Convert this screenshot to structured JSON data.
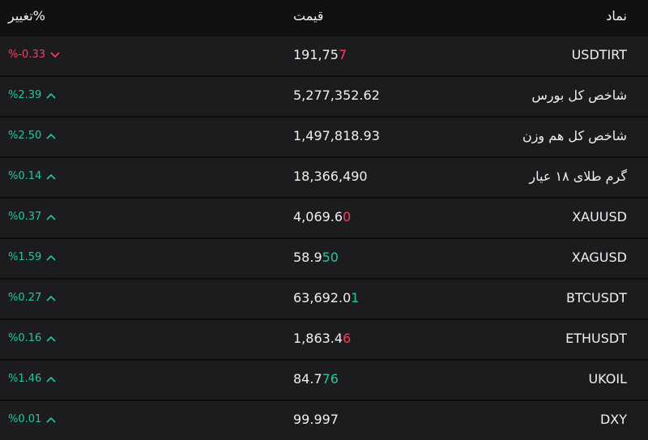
{
  "header": {
    "symbol": "نماد",
    "price": "قیمت",
    "change": "تغییر%"
  },
  "colors": {
    "up": "#26c6a0",
    "down": "#ff3b5c"
  },
  "rows": [
    {
      "symbol": "USDTIRT",
      "price_main": "191,75",
      "price_tail": "7",
      "tail_dir": "down",
      "change": "%-0.33",
      "dir": "down"
    },
    {
      "symbol": "شاخص کل بورس",
      "price_main": "5,277,352.62",
      "price_tail": "",
      "tail_dir": "up",
      "change": "%2.39",
      "dir": "up"
    },
    {
      "symbol": "شاخص کل هم وزن",
      "price_main": "1,497,818.93",
      "price_tail": "",
      "tail_dir": "up",
      "change": "%2.50",
      "dir": "up"
    },
    {
      "symbol": "گرم طلای ۱۸ عیار",
      "price_main": "18,366,490",
      "price_tail": "",
      "tail_dir": "up",
      "change": "%0.14",
      "dir": "up"
    },
    {
      "symbol": "XAUUSD",
      "price_main": "4,069.6",
      "price_tail": "0",
      "tail_dir": "down",
      "change": "%0.37",
      "dir": "up"
    },
    {
      "symbol": "XAGUSD",
      "price_main": "58.9",
      "price_tail": "50",
      "tail_dir": "up",
      "change": "%1.59",
      "dir": "up"
    },
    {
      "symbol": "BTCUSDT",
      "price_main": "63,692.0",
      "price_tail": "1",
      "tail_dir": "up",
      "change": "%0.27",
      "dir": "up"
    },
    {
      "symbol": "ETHUSDT",
      "price_main": "1,863.4",
      "price_tail": "6",
      "tail_dir": "down",
      "change": "%0.16",
      "dir": "up"
    },
    {
      "symbol": "UKOIL",
      "price_main": "84.7",
      "price_tail": "76",
      "tail_dir": "up",
      "change": "%1.46",
      "dir": "up"
    },
    {
      "symbol": "DXY",
      "price_main": "99.997",
      "price_tail": "",
      "tail_dir": "up",
      "change": "%0.01",
      "dir": "up"
    }
  ]
}
